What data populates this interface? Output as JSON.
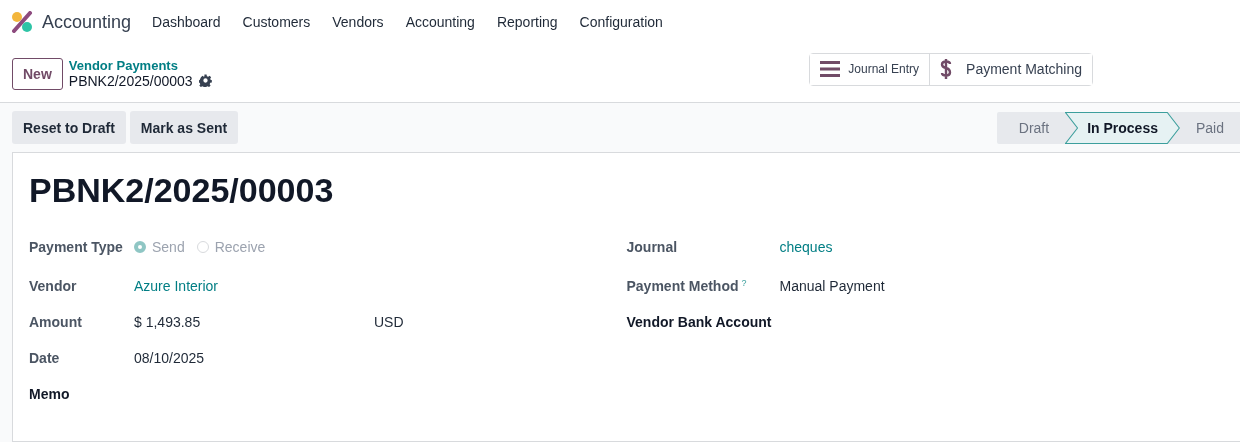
{
  "navbar": {
    "app_name": "Accounting",
    "menu": [
      "Dashboard",
      "Customers",
      "Vendors",
      "Accounting",
      "Reporting",
      "Configuration"
    ]
  },
  "control_panel": {
    "new_button": "New",
    "breadcrumb": "Vendor Payments",
    "record_name": "PBNK2/2025/00003",
    "smart_buttons": [
      {
        "kind": "list",
        "label": "Journal Entry"
      },
      {
        "kind": "dollar",
        "label": "Payment Matching"
      }
    ]
  },
  "status_bar": {
    "buttons": [
      "Reset to Draft",
      "Mark as Sent"
    ],
    "stages": [
      {
        "label": "Draft",
        "selected": false
      },
      {
        "label": "In Process",
        "selected": true
      },
      {
        "label": "Paid",
        "selected": false
      }
    ]
  },
  "form": {
    "title": "PBNK2/2025/00003",
    "left": [
      {
        "kind": "radio",
        "label": "Payment Type",
        "disabled": true,
        "options": [
          {
            "label": "Send",
            "selected": true
          },
          {
            "label": "Receive",
            "selected": false
          }
        ]
      },
      {
        "kind": "link",
        "label": "Vendor",
        "value": "Azure Interior"
      },
      {
        "kind": "amount",
        "label": "Amount",
        "value": "$ 1,493.85",
        "currency": "USD"
      },
      {
        "kind": "text",
        "label": "Date",
        "value": "08/10/2025"
      },
      {
        "kind": "empty",
        "label": "Memo"
      }
    ],
    "right": [
      {
        "kind": "link",
        "label": "Journal",
        "value": "cheques"
      },
      {
        "kind": "text",
        "label": "Payment Method",
        "help": "?",
        "value": "Manual Payment"
      },
      {
        "kind": "empty",
        "label": "Vendor Bank Account"
      }
    ]
  }
}
